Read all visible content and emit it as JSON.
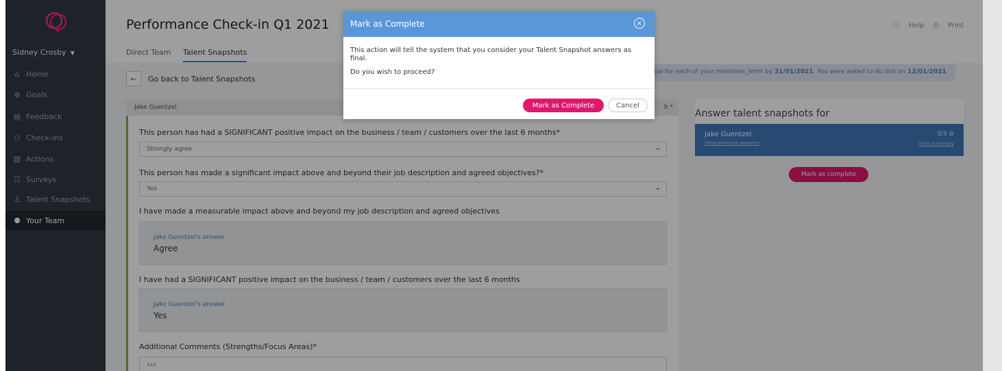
{
  "sidebar": {
    "user": "Sidney Crosby",
    "items": [
      {
        "label": "Home",
        "icon": "home-icon"
      },
      {
        "label": "Goals",
        "icon": "target-icon"
      },
      {
        "label": "Feedback",
        "icon": "feedback-icon"
      },
      {
        "label": "Check-ins",
        "icon": "people-icon"
      },
      {
        "label": "Actions",
        "icon": "actions-icon"
      },
      {
        "label": "Surveys",
        "icon": "survey-icon"
      },
      {
        "label": "Talent Snapshots",
        "icon": "person-icon"
      },
      {
        "label": "Your Team",
        "icon": "team-icon"
      }
    ]
  },
  "header": {
    "title": "Performance Check-in Q1 2021",
    "help": "Help",
    "print": "Print",
    "tabs": [
      "Direct Team",
      "Talent Snapshots"
    ]
  },
  "back": {
    "label": "Go back to Talent Snapshots"
  },
  "info": {
    "text_pre": "low for each of your members_term by ",
    "date1": "31/01/2021",
    "text_mid": ". You were asked to do this on ",
    "date2": "12/01/2021"
  },
  "panel": {
    "name": "Jake Guentzel",
    "rhs": "h *",
    "q1": "This person has had a SIGNIFICANT positive impact on the business / team / customers over the last 6 months*",
    "a1": "Strongly agree",
    "q2": "This person has made a significant impact above and beyond their job description and agreed objectives?*",
    "a2": "Yes",
    "q3": "I have made a measurable impact above and beyond my job description and agreed objectives",
    "ans3_who": "Jake Guentzel's answer",
    "ans3_val": "Agree",
    "q4": "I have had a SIGNIFICANT positive impact on the business / team / customers over the last 6 months",
    "ans4_who": "Jake Guentzel's answer",
    "ans4_val": "Yes",
    "q5": "Additional Comments (Strengths/Focus Areas)*",
    "a5": "xxx"
  },
  "right": {
    "heading": "Answer talent snapshots for",
    "name": "Jake Guentzel",
    "prev": "View previous answers",
    "count": "3/3",
    "summary": "View summary",
    "button": "Mark as complete"
  },
  "modal": {
    "title": "Mark as Complete",
    "line1": "This action will tell the system that you consider your Talent Snapshot answers as final.",
    "line2": "Do you wish to proceed?",
    "confirm": "Mark as Complete",
    "cancel": "Cancel"
  },
  "colors": {
    "accent": "#e0176b",
    "modal_header": "#5b97d8",
    "sidebar": "#2b323b",
    "selection": "#3f78ba"
  }
}
